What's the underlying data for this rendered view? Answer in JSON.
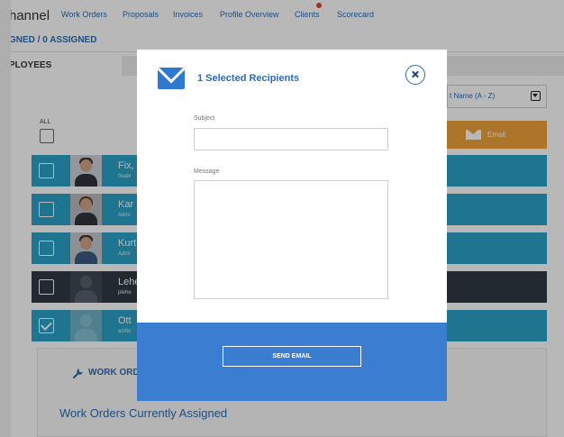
{
  "app": {
    "brand": "hannel",
    "nav": [
      "Work Orders",
      "Proposals",
      "Invoices",
      "Profile Overview",
      "Clients",
      "Scorecard"
    ],
    "assigned_summary": "GNED / 0 ASSIGNED",
    "tabs": {
      "employees": "PLOYEES"
    },
    "all_label": "ALL",
    "sort_label": "t Name (A - Z)",
    "email_button": "Email",
    "employees": [
      {
        "name": "Fix,",
        "subtitle": "fixabl",
        "checked": false,
        "style": "normal"
      },
      {
        "name": "Kar",
        "subtitle": "Admi",
        "checked": false,
        "style": "normal"
      },
      {
        "name": "Kurt",
        "subtitle": "Admi",
        "checked": false,
        "style": "normal"
      },
      {
        "name": "Lehe",
        "subtitle": "plehe",
        "checked": false,
        "style": "dark"
      },
      {
        "name": "Ott",
        "subtitle": "wotto",
        "checked": true,
        "style": "normal"
      }
    ],
    "work_orders_label": "WORK ORD",
    "work_orders_assigned": "Work Orders Currently Assigned"
  },
  "modal": {
    "title": "1 Selected Recipients",
    "subject_label": "Subject",
    "subject_value": "",
    "message_label": "Message",
    "message_value": "",
    "send_button": "SEND EMAIL"
  },
  "colors": {
    "accent_blue": "#2a6db5",
    "row_teal": "#2ba3c7",
    "row_dark": "#2f3a44",
    "email_orange": "#f0a23a",
    "modal_footer": "#3b7dd1"
  }
}
